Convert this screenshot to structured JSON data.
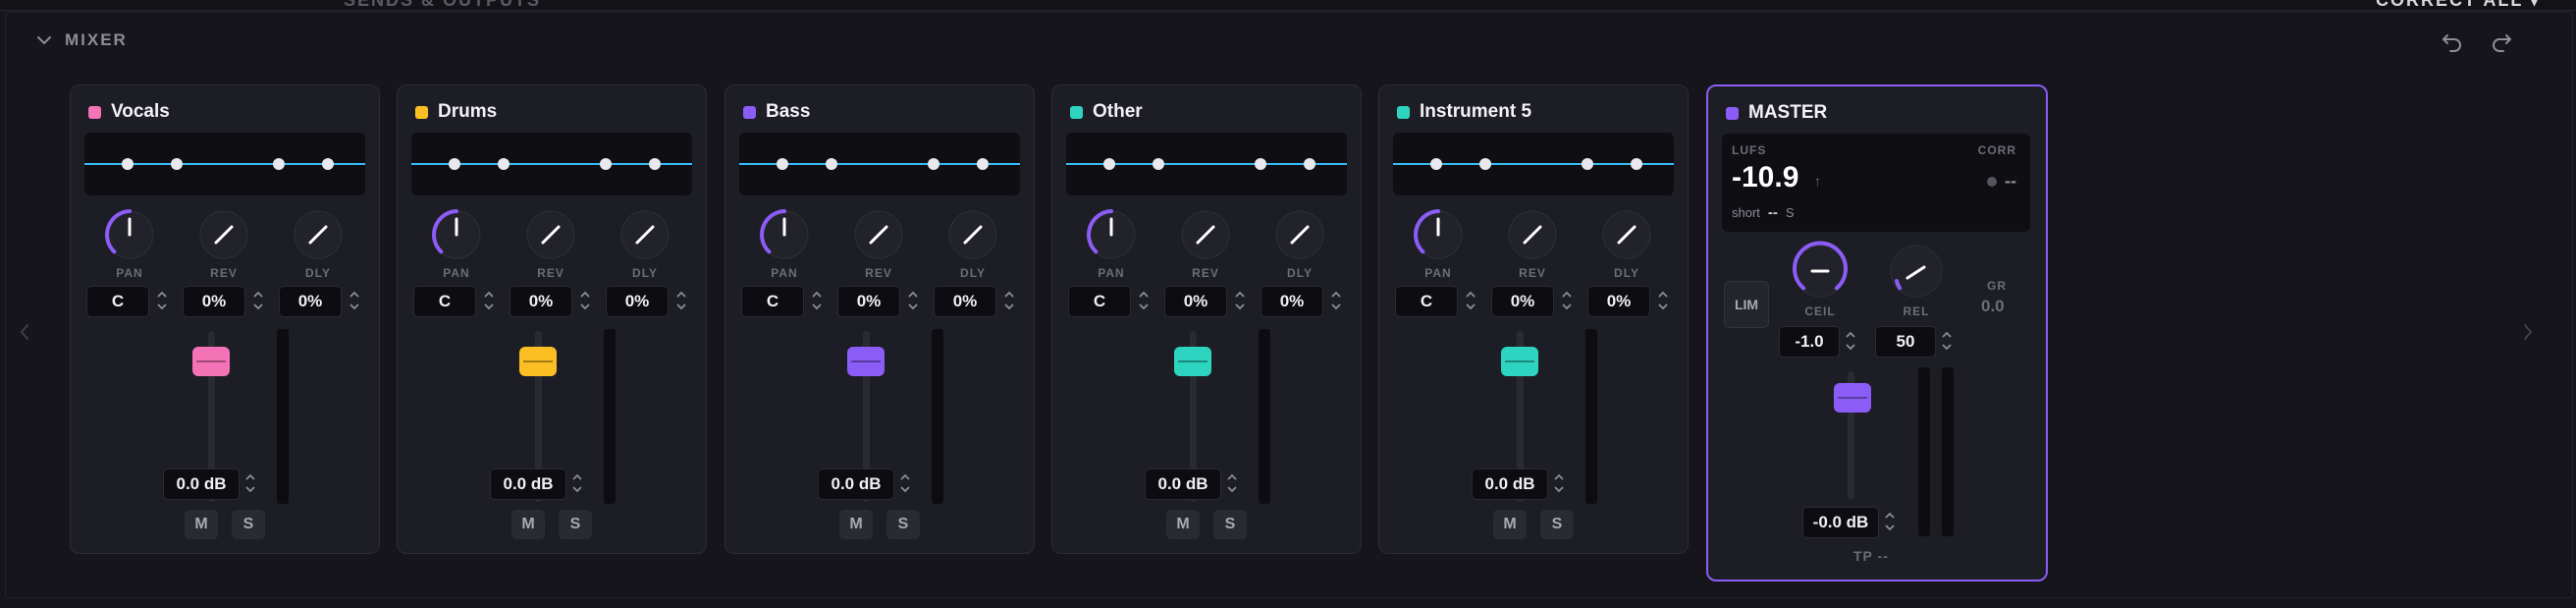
{
  "top_ghost_left": "SENDS & OUTPUTS",
  "top_ghost_right": "CORRECT ALL ▾",
  "mixer": {
    "title": "MIXER"
  },
  "knob_labels": {
    "pan": "PAN",
    "rev": "REV",
    "dly": "DLY"
  },
  "channels": [
    {
      "name": "Vocals",
      "color": "#f472b6",
      "pan": "C",
      "rev": "0%",
      "dly": "0%",
      "gain": "0.0 dB",
      "mute": "M",
      "solo": "S"
    },
    {
      "name": "Drums",
      "color": "#fbbf24",
      "pan": "C",
      "rev": "0%",
      "dly": "0%",
      "gain": "0.0 dB",
      "mute": "M",
      "solo": "S"
    },
    {
      "name": "Bass",
      "color": "#8b5cf6",
      "pan": "C",
      "rev": "0%",
      "dly": "0%",
      "gain": "0.0 dB",
      "mute": "M",
      "solo": "S"
    },
    {
      "name": "Other",
      "color": "#2dd4bf",
      "pan": "C",
      "rev": "0%",
      "dly": "0%",
      "gain": "0.0 dB",
      "mute": "M",
      "solo": "S"
    },
    {
      "name": "Instrument 5",
      "color": "#2dd4bf",
      "pan": "C",
      "rev": "0%",
      "dly": "0%",
      "gain": "0.0 dB",
      "mute": "M",
      "solo": "S"
    }
  ],
  "master": {
    "name": "MASTER",
    "color": "#8b5cf6",
    "lufs_label": "LUFS",
    "lufs_value": "-10.9",
    "lufs_arrow": "↑",
    "corr_label": "CORR",
    "corr_value": "--",
    "short_label": "short",
    "short_value": "--",
    "short_unit": "S",
    "lim_label": "LIM",
    "ceil_label": "CEIL",
    "rel_label": "REL",
    "ceil_value": "-1.0",
    "rel_value": "50",
    "gr_label": "GR",
    "gr_value": "0.0",
    "gain": "-0.0 dB",
    "tp_label": "TP --"
  },
  "icons": [
    "chevron-down-icon",
    "undo-icon",
    "redo-icon",
    "chevron-left-icon",
    "chevron-right-icon"
  ],
  "eq_line_color": "#38bdf8",
  "accent": "#8b5cf6"
}
